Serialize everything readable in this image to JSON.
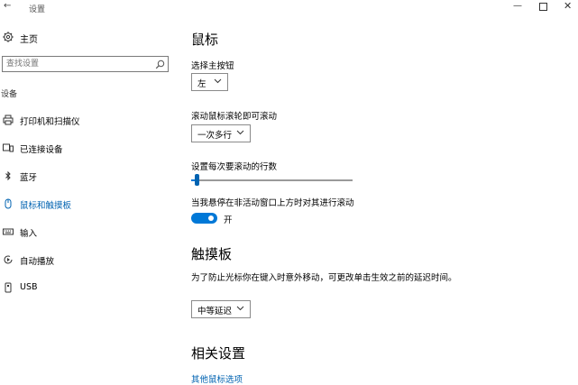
{
  "window": {
    "title": "设置",
    "back_icon": "back-arrow-icon",
    "min_glyph": "—",
    "close_glyph": "✕"
  },
  "sidebar": {
    "home": {
      "label": "主页",
      "icon": "gear-icon"
    },
    "search": {
      "placeholder": "查找设置",
      "icon": "search-icon"
    },
    "section": "设备",
    "items": [
      {
        "label": "打印机和扫描仪",
        "icon": "printer-icon",
        "active": false
      },
      {
        "label": "已连接设备",
        "icon": "connected-devices-icon",
        "active": false
      },
      {
        "label": "蓝牙",
        "icon": "bluetooth-icon",
        "active": false
      },
      {
        "label": "鼠标和触摸板",
        "icon": "mouse-icon",
        "active": true
      },
      {
        "label": "输入",
        "icon": "keyboard-icon",
        "active": false
      },
      {
        "label": "自动播放",
        "icon": "autoplay-icon",
        "active": false
      },
      {
        "label": "USB",
        "icon": "usb-icon",
        "active": false
      }
    ]
  },
  "main": {
    "mouse_heading": "鼠标",
    "primary_button_label": "选择主按钮",
    "primary_button_value": "左",
    "scroll_wheel_label": "滚动鼠标滚轮即可滚动",
    "scroll_wheel_value": "一次多行",
    "lines_label": "设置每次要滚动的行数",
    "lines_fraction": 0.02,
    "inactive_scroll_label": "当我悬停在非活动窗口上方时对其进行滚动",
    "inactive_scroll_state": "开",
    "inactive_scroll_on": true,
    "touchpad_heading": "触摸板",
    "touchpad_desc": "为了防止光标你在键入时意外移动，可更改单击生效之前的延迟时间。",
    "touchpad_delay_value": "中等延迟",
    "related_heading": "相关设置",
    "related_link": "其他鼠标选项"
  },
  "colors": {
    "accent": "#0078d7",
    "active_text": "#0063b1"
  }
}
